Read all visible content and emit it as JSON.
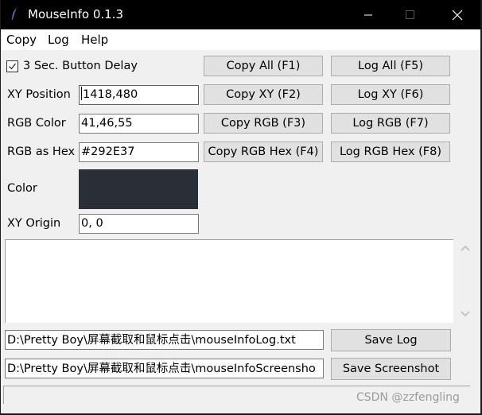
{
  "window": {
    "title": "MouseInfo 0.1.3",
    "controls": [
      "minimize",
      "maximize",
      "close"
    ]
  },
  "menu": {
    "items": [
      {
        "label": "Copy"
      },
      {
        "label": "Log"
      },
      {
        "label": "Help"
      }
    ]
  },
  "options": {
    "button_delay_label": "3 Sec. Button Delay",
    "button_delay_checked": true
  },
  "fields": {
    "xy_position": {
      "label": "XY Position",
      "value": "1418,480"
    },
    "rgb_color": {
      "label": "RGB Color",
      "value": "41,46,55"
    },
    "rgb_hex": {
      "label": "RGB as Hex",
      "value": "#292E37"
    },
    "color": {
      "label": "Color",
      "swatch": "#292E37"
    },
    "xy_origin": {
      "label": "XY Origin",
      "value": "0, 0"
    }
  },
  "buttons": {
    "copy_all": "Copy All (F1)",
    "copy_xy": "Copy XY (F2)",
    "copy_rgb": "Copy RGB (F3)",
    "copy_rgb_hex": "Copy RGB Hex (F4)",
    "log_all": "Log All (F5)",
    "log_xy": "Log XY (F6)",
    "log_rgb": "Log RGB (F7)",
    "log_rgb_hex": "Log RGB Hex (F8)",
    "save_log": "Save Log",
    "save_screenshot": "Save Screenshot"
  },
  "log": {
    "content": ""
  },
  "paths": {
    "log_file": "D:\\Pretty Boy\\屏幕截取和鼠标点击\\mouseInfoLog.txt",
    "screenshot_file": "D:\\Pretty Boy\\屏幕截取和鼠标点击\\mouseInfoScreensho"
  },
  "status": {
    "text": ""
  },
  "watermark": "CSDN @zzfengling"
}
